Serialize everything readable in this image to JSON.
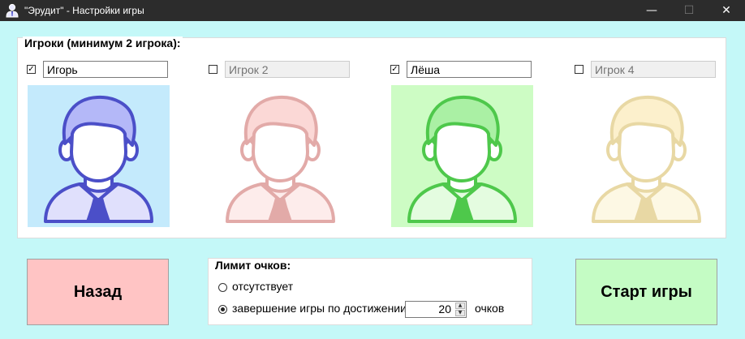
{
  "window": {
    "title": "\"Эрудит\" - Настройки игры",
    "minimize": "—",
    "maximize": "☐",
    "close": "✕"
  },
  "players_group": {
    "legend": "Игроки (минимум 2 игрока):",
    "players": [
      {
        "checked": true,
        "mark": "✓",
        "name": "Игорь",
        "placeholder": "",
        "enabled": true,
        "bg": "#c4eafc",
        "color": "#4b4fc8",
        "fill": "#b4b8f8",
        "fill_light": "#e0e0fc"
      },
      {
        "checked": false,
        "mark": "",
        "name": "",
        "placeholder": "Игрок 2",
        "enabled": false,
        "bg": "#ffffff",
        "color": "#e2aaa8",
        "fill": "#fbd8d6",
        "fill_light": "#fdeceb"
      },
      {
        "checked": true,
        "mark": "✓",
        "name": "Лёша",
        "placeholder": "",
        "enabled": true,
        "bg": "#cdfcc4",
        "color": "#4ec84b",
        "fill": "#aaf0a4",
        "fill_light": "#e4fce0"
      },
      {
        "checked": false,
        "mark": "",
        "name": "",
        "placeholder": "Игрок 4",
        "enabled": false,
        "bg": "#ffffff",
        "color": "#e8d8a4",
        "fill": "#fcf0cc",
        "fill_light": "#fdf8e4"
      }
    ]
  },
  "buttons": {
    "back_label": "Назад",
    "back_color": "#ffc4c4",
    "start_label": "Старт игры",
    "start_color": "#c4fcc4"
  },
  "limit_group": {
    "legend": "Лимит очков:",
    "option_none": "отсутствует",
    "option_limit": "завершение игры по достижении",
    "selected": "limit",
    "value": "20",
    "unit": "очков"
  }
}
